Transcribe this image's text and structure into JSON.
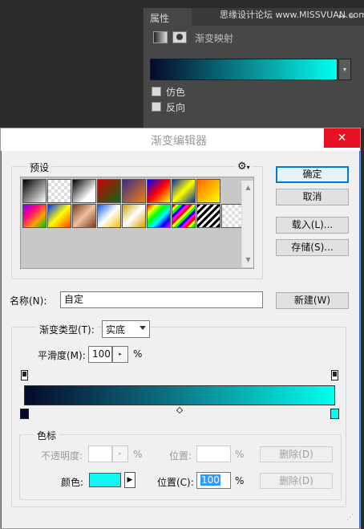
{
  "properties_panel": {
    "tab": "属性",
    "watermark": "思缘设计论坛  www.MISSVUAN.com",
    "adjustment_label": "渐变映射",
    "checkbox_dither": "仿色",
    "checkbox_reverse": "反向",
    "gradient_colors": [
      "#060a2a",
      "#0b8f95",
      "#00fff0"
    ]
  },
  "dialog": {
    "title": "渐变编辑器",
    "presets_label": "预设",
    "buttons": {
      "ok": "确定",
      "cancel": "取消",
      "load": "载入(L)...",
      "save": "存储(S)...",
      "new": "新建(W)"
    },
    "name_label": "名称(N):",
    "name_value": "自定",
    "gradient_type_label": "渐变类型(T):",
    "gradient_type_value": "实底",
    "smoothness_label": "平滑度(M):",
    "smoothness_value": "100",
    "percent": "%",
    "stops_group_label": "色标",
    "opacity_label": "不透明度:",
    "location_label_1": "位置:",
    "delete_label_1": "删除(D)",
    "color_label": "颜色:",
    "location_label_2": "位置(C):",
    "location_value_2": "100",
    "delete_label_2": "删除(D)",
    "gradient_start_color": "#060a2a",
    "gradient_end_color": "#00fff0"
  },
  "icons": {
    "gear": "⚙",
    "close": "✕",
    "stepper": "▸",
    "color_arrow": "▶",
    "scroll_up": "▲",
    "scroll_down": "▼"
  }
}
